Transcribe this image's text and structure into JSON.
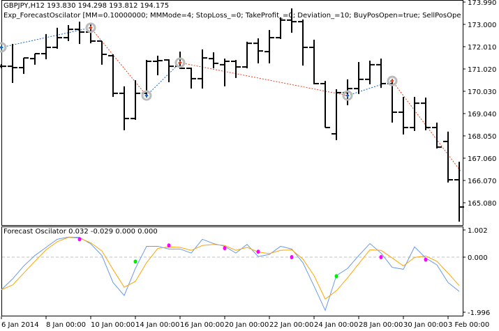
{
  "header": {
    "symbol_line": "GBPJPY,H12  193.830 194.298 193.812 194.175",
    "expert_line": "Exp_ForecastOscilator [MM=0.10000000; MMMode=4; StopLoss_=0; TakeProfit_=0; Deviation_=10; BuyPosOpen=true; SellPosOpen=true; BuyPosClose=true"
  },
  "indicator": {
    "label": "Forecast Oscilator 0.032 -0.029 0.000 0.000"
  },
  "colors": {
    "bars": "#000000",
    "buy_line": "#1565c0",
    "sell_line": "#e8401c",
    "osc_main": "#6699ee",
    "osc_signal": "#ffa500",
    "dot_sell": "#ff00ff",
    "dot_buy": "#00ee00",
    "zero_line": "#c0c0c0"
  },
  "chart_data": [
    {
      "type": "ohlc",
      "title": "GBPJPY,H12",
      "price_axis_labels": [
        "173.990",
        "173.000",
        "172.010",
        "171.020",
        "170.030",
        "169.040",
        "168.050",
        "167.060",
        "166.070",
        "165.080"
      ],
      "price_axis_values": [
        173.99,
        173.0,
        172.01,
        171.02,
        170.03,
        169.04,
        168.05,
        167.06,
        166.07,
        165.08
      ],
      "bars": [
        [
          171.14,
          171.24,
          171.05,
          171.14
        ],
        [
          171.14,
          172.13,
          170.4,
          171.08
        ],
        [
          171.08,
          171.51,
          170.8,
          171.51
        ],
        [
          171.48,
          171.7,
          171.21,
          171.7
        ],
        [
          171.7,
          172.57,
          171.45,
          171.98
        ],
        [
          171.98,
          172.85,
          171.92,
          172.41
        ],
        [
          172.41,
          172.97,
          172.26,
          172.78
        ],
        [
          172.78,
          173.12,
          172.13,
          172.66
        ],
        [
          172.66,
          173.0,
          172.16,
          172.26
        ],
        [
          172.26,
          172.26,
          171.21,
          171.67
        ],
        [
          171.61,
          171.67,
          169.78,
          169.94
        ],
        [
          169.94,
          170.25,
          168.3,
          168.82
        ],
        [
          168.82,
          170.52,
          168.76,
          169.94
        ],
        [
          169.94,
          171.42,
          169.88,
          171.36
        ],
        [
          171.36,
          171.61,
          170.74,
          171.39
        ],
        [
          171.42,
          171.45,
          170.43,
          171.14
        ],
        [
          171.14,
          171.79,
          171.02,
          171.05
        ],
        [
          171.05,
          171.08,
          170.15,
          170.59
        ],
        [
          170.59,
          171.89,
          170.15,
          171.51
        ],
        [
          171.48,
          171.76,
          171.05,
          171.27
        ],
        [
          171.21,
          171.48,
          170.25,
          171.36
        ],
        [
          171.36,
          171.42,
          170.62,
          171.11
        ],
        [
          171.11,
          172.23,
          171.05,
          172.16
        ],
        [
          172.16,
          172.38,
          171.27,
          171.82
        ],
        [
          171.79,
          172.75,
          171.27,
          172.41
        ],
        [
          172.41,
          173.31,
          172.35,
          173.19
        ],
        [
          173.19,
          173.71,
          172.63,
          173.12
        ],
        [
          173.12,
          173.22,
          171.17,
          171.98
        ],
        [
          171.98,
          172.32,
          170.34,
          170.37
        ],
        [
          170.37,
          170.49,
          168.42,
          168.42
        ],
        [
          168.14,
          170.12,
          167.86,
          169.97
        ],
        [
          169.97,
          170.56,
          169.41,
          170.15
        ],
        [
          170.15,
          171.33,
          169.91,
          170.56
        ],
        [
          170.56,
          171.39,
          170.34,
          171.21
        ],
        [
          171.21,
          171.48,
          170.18,
          170.37
        ],
        [
          170.37,
          170.52,
          168.64,
          169.1
        ],
        [
          169.1,
          169.78,
          168.11,
          168.42
        ],
        [
          168.42,
          169.78,
          168.27,
          169.5
        ],
        [
          169.5,
          169.75,
          168.3,
          168.42
        ],
        [
          168.42,
          168.64,
          167.49,
          167.55
        ],
        [
          167.8,
          168.24,
          165.98,
          166.1
        ],
        [
          166.1,
          166.9,
          164.24,
          164.89
        ]
      ],
      "trades": [
        {
          "type": "buy",
          "bar": 0,
          "price": 171.98
        },
        {
          "type": "sell",
          "bar": 8,
          "price": 172.85
        },
        {
          "type": "buy",
          "bar": 13,
          "price": 169.84
        },
        {
          "type": "sell",
          "bar": 16,
          "price": 171.3
        },
        {
          "type": "buy",
          "bar": 31,
          "price": 169.84
        },
        {
          "type": "sell",
          "bar": 35,
          "price": 170.49
        },
        {
          "type": "open",
          "bar": 41.1,
          "price": 166.5
        }
      ],
      "time_labels": [
        "6 Jan 2014",
        "8 Jan 00:00",
        "10 Jan 00:00",
        "14 Jan 00:00",
        "16 Jan 00:00",
        "20 Jan 00:00",
        "22 Jan 00:00",
        "24 Jan 00:00",
        "28 Jan 00:00",
        "30 Jan 00:00",
        "3 Feb 00:00"
      ],
      "time_label_bars": [
        0,
        4,
        8,
        12,
        16,
        20,
        24,
        28,
        32,
        36,
        40
      ]
    },
    {
      "type": "line",
      "title": "Forecast Oscilator",
      "ylim": [
        -1.996,
        1.002
      ],
      "y_axis_labels": [
        "1.002",
        "0.000",
        "-1.996"
      ],
      "y_axis_values": [
        1.002,
        0.0,
        -1.996
      ],
      "series": [
        {
          "name": "main",
          "values": [
            -1.18,
            -0.79,
            -0.32,
            0.06,
            0.36,
            0.66,
            0.74,
            0.73,
            0.49,
            0.06,
            -0.92,
            -1.39,
            -0.41,
            0.4,
            0.4,
            0.3,
            0.3,
            0.15,
            0.66,
            0.5,
            0.4,
            0.15,
            0.47,
            0.02,
            0.1,
            0.4,
            0.3,
            -0.2,
            -1.05,
            -1.93,
            -0.67,
            -0.41,
            0.06,
            0.5,
            0.15,
            -0.37,
            -0.44,
            0.38,
            -0.03,
            -0.28,
            -0.92,
            -1.24
          ]
        },
        {
          "name": "signal",
          "values": [
            -1.18,
            -1.01,
            -0.58,
            -0.15,
            0.27,
            0.57,
            0.73,
            0.7,
            0.53,
            0.23,
            -0.45,
            -1.09,
            -0.88,
            -0.2,
            0.32,
            0.38,
            0.36,
            0.25,
            0.43,
            0.47,
            0.43,
            0.25,
            0.36,
            0.19,
            0.13,
            0.25,
            0.27,
            -0.07,
            -0.67,
            -1.52,
            -1.22,
            -0.75,
            -0.24,
            0.27,
            0.25,
            -0.03,
            -0.32,
            -0.01,
            0.04,
            -0.15,
            -0.58,
            -1.03
          ]
        }
      ],
      "signals": [
        {
          "type": "sell",
          "bar": 7,
          "value": 0.66
        },
        {
          "type": "buy",
          "bar": 12,
          "value": -0.16
        },
        {
          "type": "sell",
          "bar": 15,
          "value": 0.43
        },
        {
          "type": "sell",
          "bar": 20,
          "value": 0.33
        },
        {
          "type": "sell",
          "bar": 23,
          "value": 0.2
        },
        {
          "type": "sell",
          "bar": 26,
          "value": 0.0
        },
        {
          "type": "buy",
          "bar": 30,
          "value": -0.69
        },
        {
          "type": "sell",
          "bar": 34,
          "value": 0.0
        },
        {
          "type": "sell",
          "bar": 38,
          "value": -0.09
        }
      ]
    }
  ]
}
